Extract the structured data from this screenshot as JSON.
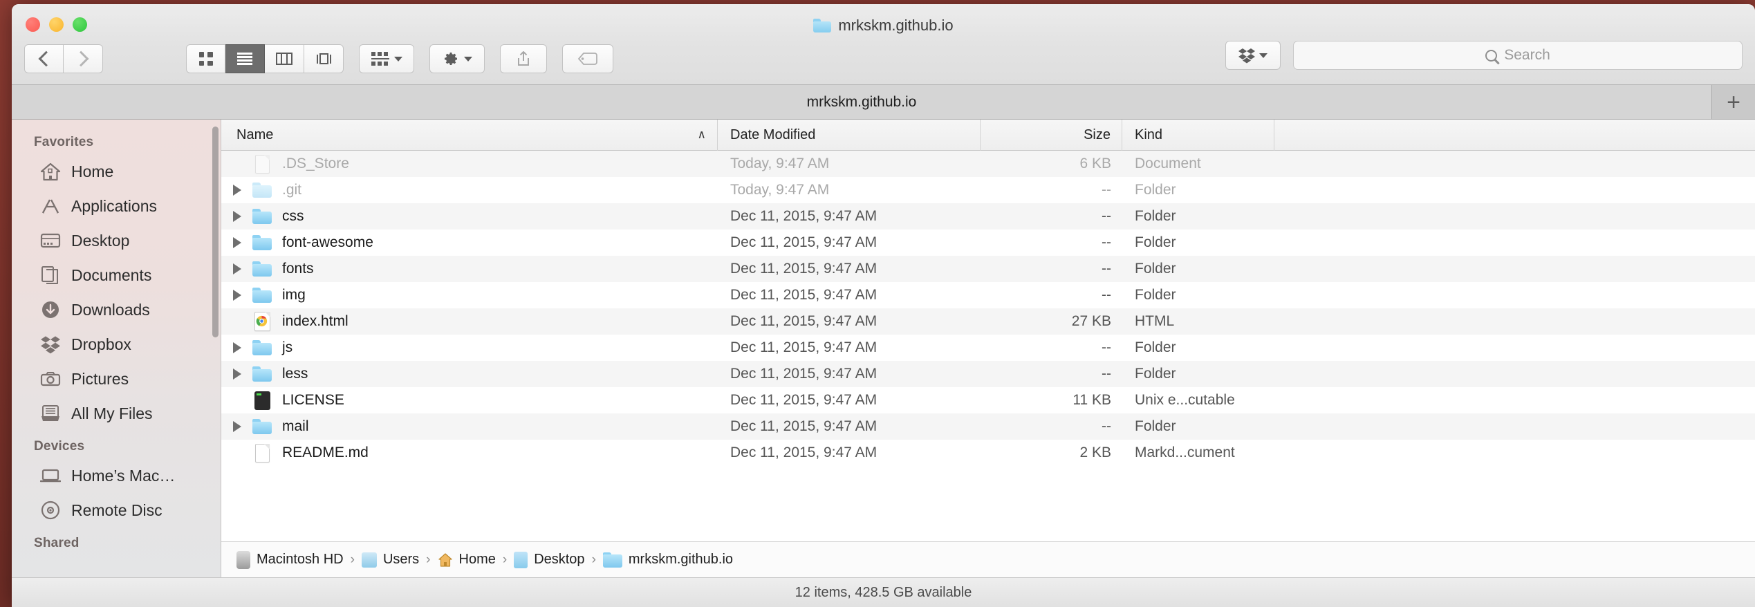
{
  "window": {
    "title": "mrkskm.github.io",
    "traffic_lights": [
      "close",
      "minimize",
      "zoom"
    ]
  },
  "toolbar": {
    "back_label": "Back",
    "forward_label": "Forward",
    "view_modes": [
      {
        "name": "icon-view",
        "label": "Icon View",
        "active": false
      },
      {
        "name": "list-view",
        "label": "List View",
        "active": true
      },
      {
        "name": "column-view",
        "label": "Column View",
        "active": false
      },
      {
        "name": "coverflow-view",
        "label": "Cover Flow View",
        "active": false
      }
    ],
    "arrange_label": "Arrange",
    "action_label": "Action",
    "share_label": "Share",
    "tags_label": "Tags",
    "dropbox_label": "Dropbox"
  },
  "search": {
    "placeholder": "Search",
    "value": ""
  },
  "tabs": {
    "active_label": "mrkskm.github.io",
    "add_label": "+"
  },
  "sidebar": {
    "sections": [
      {
        "heading": "Favorites",
        "items": [
          {
            "label": "Home",
            "icon": "house-icon"
          },
          {
            "label": "Applications",
            "icon": "applications-icon"
          },
          {
            "label": "Desktop",
            "icon": "desktop-icon"
          },
          {
            "label": "Documents",
            "icon": "documents-icon"
          },
          {
            "label": "Downloads",
            "icon": "downloads-icon"
          },
          {
            "label": "Dropbox",
            "icon": "dropbox-icon"
          },
          {
            "label": "Pictures",
            "icon": "camera-icon"
          },
          {
            "label": "All My Files",
            "icon": "all-my-files-icon"
          }
        ]
      },
      {
        "heading": "Devices",
        "items": [
          {
            "label": "Home’s Mac…",
            "icon": "laptop-icon"
          },
          {
            "label": "Remote Disc",
            "icon": "disc-icon"
          }
        ]
      },
      {
        "heading": "Shared",
        "items": []
      }
    ]
  },
  "file_list": {
    "columns": [
      {
        "key": "name",
        "label": "Name",
        "sorted": "ascending",
        "sort_glyph": "∧"
      },
      {
        "key": "date",
        "label": "Date Modified"
      },
      {
        "key": "size",
        "label": "Size"
      },
      {
        "key": "kind",
        "label": "Kind"
      }
    ],
    "rows": [
      {
        "name": ".DS_Store",
        "date": "Today, 9:47 AM",
        "size": "6 KB",
        "kind": "Document",
        "icon": "document-icon",
        "expandable": false,
        "dimmed": true
      },
      {
        "name": ".git",
        "date": "Today, 9:47 AM",
        "size": "--",
        "kind": "Folder",
        "icon": "folder-icon",
        "expandable": true,
        "dimmed": true
      },
      {
        "name": "css",
        "date": "Dec 11, 2015, 9:47 AM",
        "size": "--",
        "kind": "Folder",
        "icon": "folder-icon",
        "expandable": true,
        "dimmed": false
      },
      {
        "name": "font-awesome",
        "date": "Dec 11, 2015, 9:47 AM",
        "size": "--",
        "kind": "Folder",
        "icon": "folder-icon",
        "expandable": true,
        "dimmed": false
      },
      {
        "name": "fonts",
        "date": "Dec 11, 2015, 9:47 AM",
        "size": "--",
        "kind": "Folder",
        "icon": "folder-icon",
        "expandable": true,
        "dimmed": false
      },
      {
        "name": "img",
        "date": "Dec 11, 2015, 9:47 AM",
        "size": "--",
        "kind": "Folder",
        "icon": "folder-icon",
        "expandable": true,
        "dimmed": false
      },
      {
        "name": "index.html",
        "date": "Dec 11, 2015, 9:47 AM",
        "size": "27 KB",
        "kind": "HTML",
        "icon": "chrome-html-icon",
        "expandable": false,
        "dimmed": false
      },
      {
        "name": "js",
        "date": "Dec 11, 2015, 9:47 AM",
        "size": "--",
        "kind": "Folder",
        "icon": "folder-icon",
        "expandable": true,
        "dimmed": false
      },
      {
        "name": "less",
        "date": "Dec 11, 2015, 9:47 AM",
        "size": "--",
        "kind": "Folder",
        "icon": "folder-icon",
        "expandable": true,
        "dimmed": false
      },
      {
        "name": "LICENSE",
        "date": "Dec 11, 2015, 9:47 AM",
        "size": "11 KB",
        "kind": "Unix e...cutable",
        "icon": "unix-executable-icon",
        "expandable": false,
        "dimmed": false
      },
      {
        "name": "mail",
        "date": "Dec 11, 2015, 9:47 AM",
        "size": "--",
        "kind": "Folder",
        "icon": "folder-icon",
        "expandable": true,
        "dimmed": false
      },
      {
        "name": "README.md",
        "date": "Dec 11, 2015, 9:47 AM",
        "size": "2 KB",
        "kind": "Markd...cument",
        "icon": "document-icon",
        "expandable": false,
        "dimmed": false
      }
    ]
  },
  "path_bar": {
    "crumbs": [
      {
        "label": "Macintosh HD",
        "icon": "harddisk-icon"
      },
      {
        "label": "Users",
        "icon": "users-icon"
      },
      {
        "label": "Home",
        "icon": "home-icon"
      },
      {
        "label": "Desktop",
        "icon": "desktop-folder-icon"
      },
      {
        "label": "mrkskm.github.io",
        "icon": "folder-icon"
      }
    ],
    "separator": "›"
  },
  "status_bar": {
    "text": "12 items, 428.5 GB available"
  },
  "colors": {
    "desktop": "#8a3a31",
    "sidebar_tint": "#efdfdd",
    "folder_blue": "#8ed2f3",
    "view_active": "#6d6d6d"
  }
}
